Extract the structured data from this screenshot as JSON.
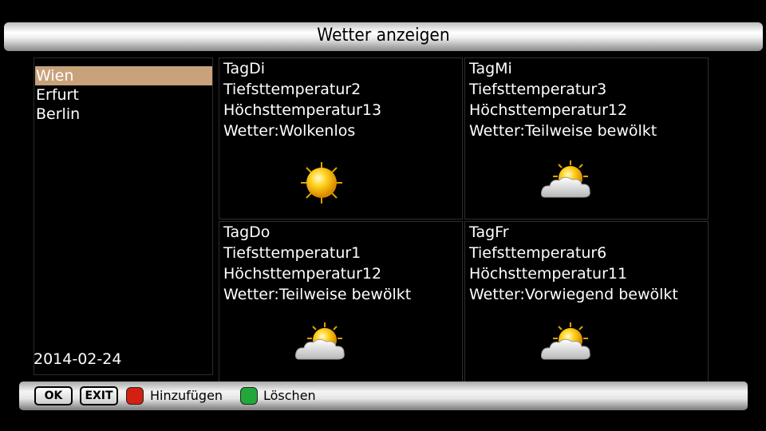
{
  "header": {
    "title": "Wetter anzeigen"
  },
  "cities": {
    "items": [
      "Wien",
      "Erfurt",
      "Berlin"
    ],
    "selected_index": 0
  },
  "date": "2014-02-24",
  "forecast": [
    {
      "day": "TagDi",
      "min": "Tiefsttemperatur2",
      "max": "Höchsttemperatur13",
      "weather": "Wetter:Wolkenlos",
      "icon": "sun-icon"
    },
    {
      "day": "TagMi",
      "min": "Tiefsttemperatur3",
      "max": "Höchsttemperatur12",
      "weather": "Wetter:Teilweise bewölkt",
      "icon": "sun-cloud-icon"
    },
    {
      "day": "TagDo",
      "min": "Tiefsttemperatur1",
      "max": "Höchsttemperatur12",
      "weather": "Wetter:Teilweise bewölkt",
      "icon": "sun-cloud-icon"
    },
    {
      "day": "TagFr",
      "min": "Tiefsttemperatur6",
      "max": "Höchsttemperatur11",
      "weather": "Wetter:Vorwiegend bewölkt",
      "icon": "sun-cloud-icon"
    }
  ],
  "footer": {
    "ok_label": "OK",
    "exit_label": "EXIT",
    "red_label": "Hinzufügen",
    "green_label": "Löschen",
    "red_color": "#d42010",
    "green_color": "#22a83a"
  },
  "colors": {
    "selection": "#c8a27a",
    "sun": "#f5c400"
  }
}
